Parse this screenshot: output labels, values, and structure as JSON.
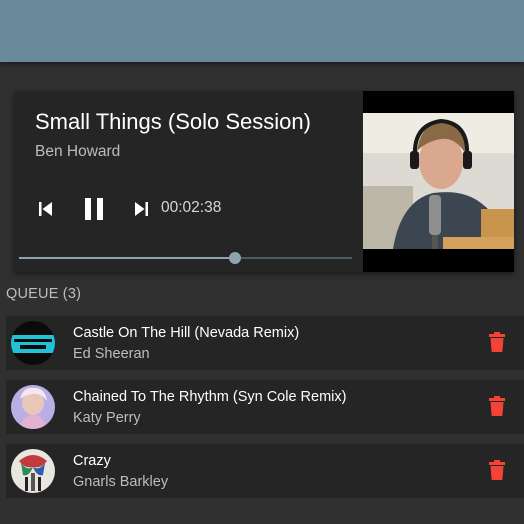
{
  "player": {
    "title": "Small Things (Solo Session)",
    "artist": "Ben Howard",
    "time": "00:02:38",
    "progress_fraction": 0.65,
    "controls": {
      "previous": "skip-previous-icon",
      "pause": "pause-icon",
      "next": "skip-next-icon"
    }
  },
  "queue": {
    "header": "QUEUE (3)",
    "items": [
      {
        "title": "Castle On The Hill (Nevada Remix)",
        "artist": "Ed Sheeran"
      },
      {
        "title": "Chained To The Rhythm (Syn Cole Remix)",
        "artist": "Katy Perry"
      },
      {
        "title": "Crazy",
        "artist": "Gnarls Barkley"
      }
    ]
  },
  "colors": {
    "appbar": "#6a8a9b",
    "background": "#303030",
    "card": "#252525",
    "delete": "#f44336",
    "slider": "#8fa3ae"
  }
}
